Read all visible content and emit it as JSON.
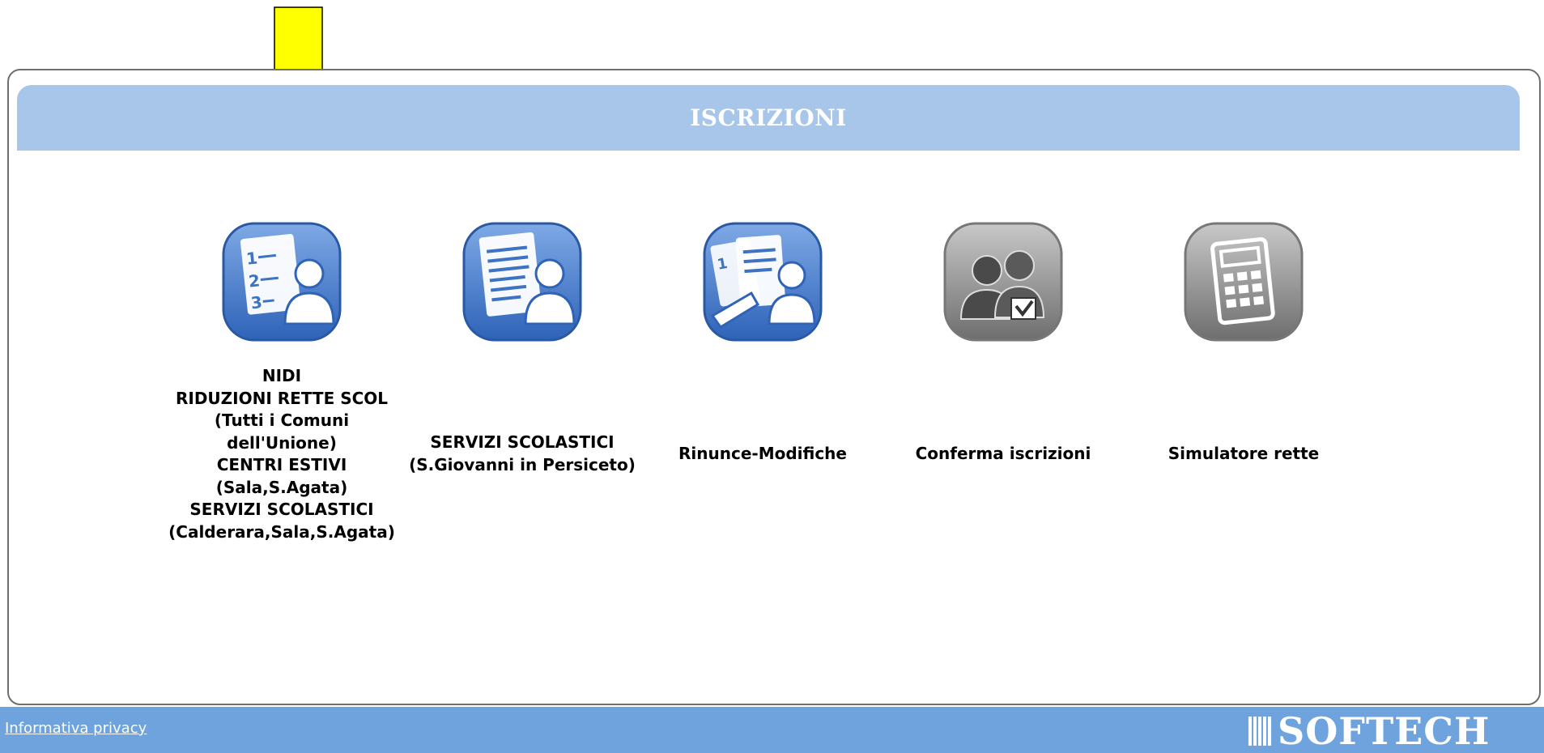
{
  "header": {
    "title": "ISCRIZIONI"
  },
  "tiles": [
    {
      "lines": [
        "NIDI",
        "RIDUZIONI RETTE SCOL",
        "(Tutti i Comuni",
        "dell'Unione)",
        "CENTRI ESTIVI",
        "(Sala,S.Agata)",
        "SERVIZI SCOLASTICI",
        "(Calderara,Sala,S.Agata)"
      ],
      "icon": "numbered-list-person-icon"
    },
    {
      "lines": [
        "SERVIZI SCOLASTICI",
        "(S.Giovanni in Persiceto)"
      ],
      "icon": "document-person-icon"
    },
    {
      "lines": [
        "Rinunce-Modifiche"
      ],
      "icon": "documents-pen-person-icon"
    },
    {
      "lines": [
        "Conferma iscrizioni"
      ],
      "icon": "people-check-icon"
    },
    {
      "lines": [
        "Simulatore rette"
      ],
      "icon": "calculator-icon"
    }
  ],
  "footer": {
    "privacy_link": "Informativa privacy",
    "brand": "SOFTECH"
  },
  "colors": {
    "header": "#a7c6ea",
    "footer": "#6fa3dd",
    "icon_blue": "#3d73c2",
    "icon_gray": "#8a8a8a",
    "arrow": "#ffff00"
  }
}
